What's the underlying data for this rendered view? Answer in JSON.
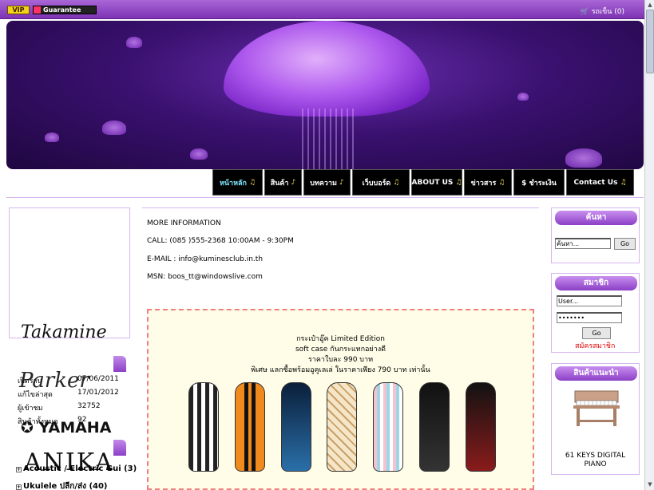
{
  "topbar": {
    "vip": "VIP",
    "guarantee": "Guarantee",
    "cart": "รถเข็น (0)"
  },
  "nav": [
    {
      "label": "หน้าหลัก",
      "note": "♫"
    },
    {
      "label": "สินค้า",
      "note": "♪"
    },
    {
      "label": "บทความ",
      "note": "♪"
    },
    {
      "label": "เว็บบอร์ด",
      "note": "♫"
    },
    {
      "label": "ABOUT US",
      "note": "♫"
    },
    {
      "label": "ข่าวสาร",
      "note": "♫"
    },
    {
      "label": "$ ชำระเงิน",
      "note": ""
    },
    {
      "label": "Contact Us",
      "note": "♫"
    }
  ],
  "left": {
    "logos": [
      "Takamine",
      "Parker",
      "YAMAHA",
      "ANIKA"
    ],
    "stats": [
      {
        "label": "เปิดร้าน",
        "value": "07/06/2011"
      },
      {
        "label": "แก้ไขล่าสุด",
        "value": "17/01/2012"
      },
      {
        "label": "ผู้เข้าชม",
        "value": "32752"
      },
      {
        "label": "สินค้าทั้งหมด",
        "value": "92"
      }
    ],
    "categories": [
      "Acoustic / Electric Gui (3)",
      "Ukulele ปลีก/ส่ง (40)"
    ]
  },
  "center": {
    "info_title": "MORE INFORMATION",
    "call": "CALL: (085 )555-2368   10:00AM - 9:30PM",
    "email": "E-MAIL : info@kuminesclub.in.th",
    "msn": "MSN: boos_tt@windowslive.com",
    "promo": [
      "กระเป๋าอู๊ค Limited Edition",
      "soft case กันกระแทกอย่างดี",
      "ราคาใบละ 990 บาท",
      "พิเศษ แลกซื้อพร้อมอูคูเลเล่ ในราคาเพียง 790 บาท เท่านั้น"
    ]
  },
  "right": {
    "search_title": "ค้นหา",
    "search_value": "ค้นหา...",
    "go": "Go",
    "member_title": "สมาชิก",
    "user_value": "User...",
    "password_mask": "•••••••",
    "login_go": "Go",
    "register": "สมัครสมาชิก",
    "featured_title": "สินค้าแนะนำ",
    "product_name_1": "61 KEYS DIGITAL",
    "product_name_2": "PIANO"
  },
  "colors": {
    "topbar": "#7d33b3",
    "banner": "#3a1170",
    "accent": "#8b3fc6",
    "border": "#d7b6ee",
    "promo_border": "#f08080"
  }
}
